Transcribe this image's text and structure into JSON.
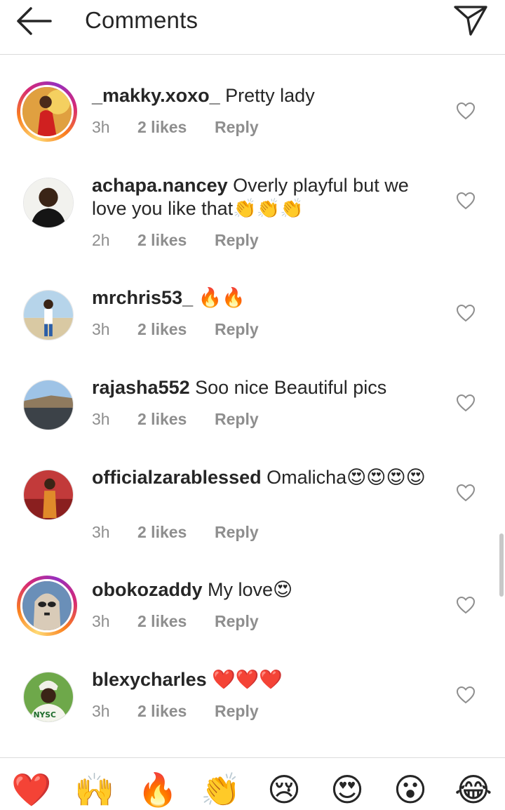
{
  "header": {
    "title": "Comments",
    "back_icon": "arrow-left-icon",
    "send_icon": "paper-plane-icon"
  },
  "comments": [
    {
      "username": "_makky.xoxo_",
      "text": "Pretty lady",
      "time": "3h",
      "likes": "2 likes",
      "reply": "Reply",
      "story_ring": true
    },
    {
      "username": "achapa.nancey",
      "text": "Overly playful but we love you like that👏👏👏",
      "time": "2h",
      "likes": "2 likes",
      "reply": "Reply",
      "story_ring": false
    },
    {
      "username": "mrchris53_",
      "text": "🔥🔥",
      "time": "3h",
      "likes": "2 likes",
      "reply": "Reply",
      "story_ring": false
    },
    {
      "username": "rajasha552",
      "text": "Soo nice Beautiful pics",
      "time": "3h",
      "likes": "2 likes",
      "reply": "Reply",
      "story_ring": false
    },
    {
      "username": "officialzarablessed",
      "text": "Omalicha😍😍😍😍",
      "time": "3h",
      "likes": "2 likes",
      "reply": "Reply",
      "story_ring": false
    },
    {
      "username": "obokozaddy",
      "text": "My love😍",
      "time": "3h",
      "likes": "2 likes",
      "reply": "Reply",
      "story_ring": true
    },
    {
      "username": "blexycharles",
      "text": "❤️❤️❤️",
      "time": "3h",
      "likes": "2 likes",
      "reply": "Reply",
      "story_ring": false
    }
  ],
  "emoji_bar": [
    "❤️",
    "🙌",
    "🔥",
    "👏",
    "😢",
    "😍",
    "😮",
    "😂"
  ],
  "colors": {
    "text": "#262626",
    "meta": "#8e8e8e",
    "divider": "#dbdbdb"
  }
}
